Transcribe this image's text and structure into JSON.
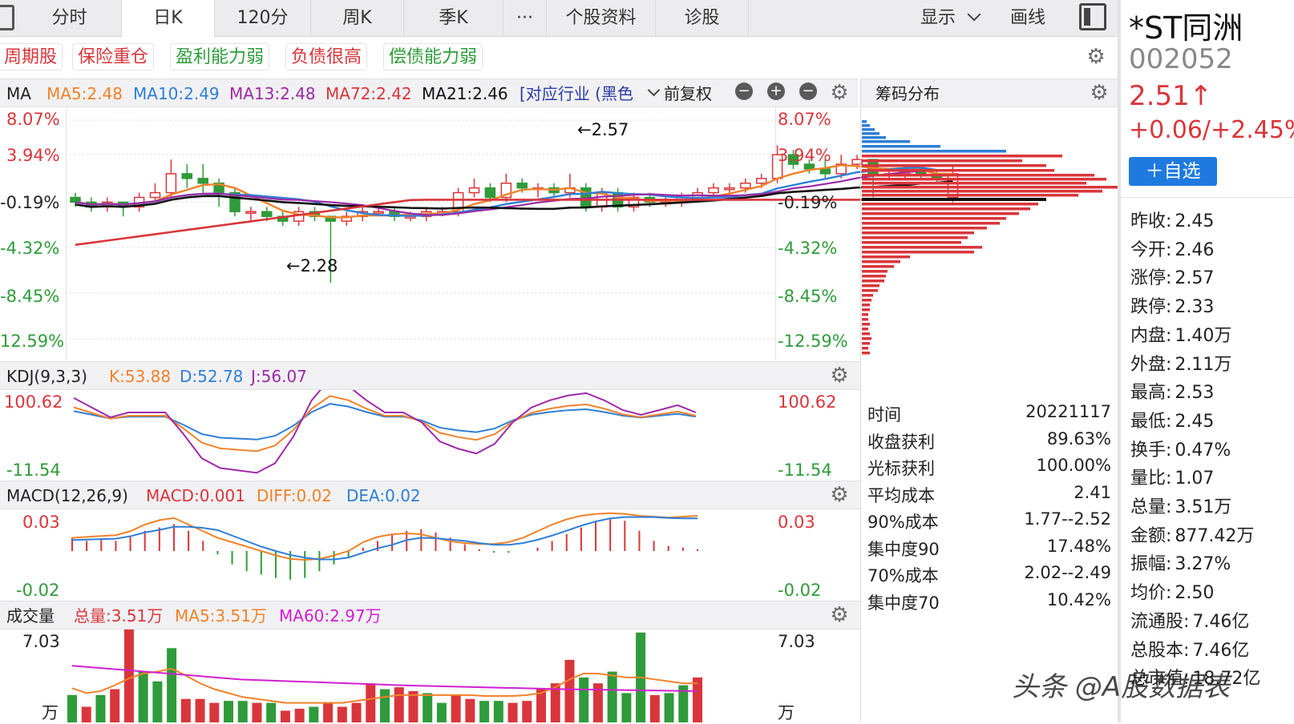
{
  "tabs": [
    {
      "label": "分时",
      "active": false
    },
    {
      "label": "日K",
      "active": true
    },
    {
      "label": "120分",
      "active": false
    },
    {
      "label": "周K",
      "active": false
    },
    {
      "label": "季K",
      "active": false
    },
    {
      "label": "···",
      "active": false
    },
    {
      "label": "个股资料",
      "active": false
    },
    {
      "label": "诊股",
      "active": false
    }
  ],
  "toolbar": {
    "display_label": "显示",
    "draw_label": "画线"
  },
  "tags": [
    {
      "label": "周期股",
      "color": "red"
    },
    {
      "label": "保险重仓",
      "color": "red"
    },
    {
      "label": "盈利能力弱",
      "color": "green"
    },
    {
      "label": "负债很高",
      "color": "red"
    },
    {
      "label": "偿债能力弱",
      "color": "green"
    }
  ],
  "ma_header": {
    "title": "MA",
    "ma5": "MA5:2.48",
    "ma10": "MA10:2.49",
    "ma13": "MA13:2.48",
    "ma72": "MA72:2.42",
    "ma21": "MA21:2.46",
    "industry": "[对应行业 (黑色",
    "adjust": "前复权"
  },
  "price_axis": [
    "8.07%",
    "3.94%",
    "-0.19%",
    "-4.32%",
    "-8.45%",
    "12.59%"
  ],
  "price_axis_right": [
    "8.07%",
    "3.94%",
    "-0.19%",
    "-4.32%",
    "-8.45%",
    "-12.59%"
  ],
  "annotations": {
    "high": "←2.57",
    "low": "←2.28"
  },
  "chip": {
    "title": "筹码分布",
    "rows": [
      {
        "k": "时间",
        "v": "20221117"
      },
      {
        "k": "收盘获利",
        "v": "89.63%"
      },
      {
        "k": "光标获利",
        "v": "100.00%"
      },
      {
        "k": "平均成本",
        "v": "2.41"
      },
      {
        "k": "90%成本",
        "v": "1.77--2.52"
      },
      {
        "k": "集中度90",
        "v": "17.48%"
      },
      {
        "k": "70%成本",
        "v": "2.02--2.49"
      },
      {
        "k": "集中度70",
        "v": "10.42%"
      }
    ]
  },
  "kdj": {
    "title": "KDJ(9,3,3)",
    "k": "K:53.88",
    "d": "D:52.78",
    "j": "J:56.07",
    "top": "100.62",
    "bottom": "-11.54"
  },
  "macd": {
    "title": "MACD(12,26,9)",
    "macd": "MACD:0.001",
    "diff": "DIFF:0.02",
    "dea": "DEA:0.02",
    "top": "0.03",
    "bottom": "-0.02"
  },
  "volume": {
    "title": "成交量",
    "total": "总量:3.51万",
    "ma5": "MA5:3.51万",
    "ma60": "MA60:2.97万",
    "top": "7.03",
    "unit": "万"
  },
  "stock": {
    "name": "*ST同洲",
    "code": "002052",
    "price": "2.51↑",
    "change": "+0.06/+2.45%",
    "watch_label": "＋自选"
  },
  "quote": [
    {
      "k": "昨收:",
      "v": "2.45",
      "c": "black"
    },
    {
      "k": "今开:",
      "v": "2.46",
      "c": "red"
    },
    {
      "k": "涨停:",
      "v": "2.57",
      "c": "red"
    },
    {
      "k": "跌停:",
      "v": "2.33",
      "c": "green"
    },
    {
      "k": "内盘:",
      "v": "1.40万",
      "c": "green"
    },
    {
      "k": "外盘:",
      "v": "2.11万",
      "c": "red"
    },
    {
      "k": "最高:",
      "v": "2.53",
      "c": "red"
    },
    {
      "k": "最低:",
      "v": "2.45",
      "c": "black"
    },
    {
      "k": "换手:",
      "v": "0.47%",
      "c": "black"
    },
    {
      "k": "量比:",
      "v": "1.07",
      "c": "black"
    },
    {
      "k": "总量:",
      "v": "3.51万",
      "c": "black"
    },
    {
      "k": "金额:",
      "v": "877.42万",
      "c": "black"
    },
    {
      "k": "振幅:",
      "v": "3.27%",
      "c": "black"
    },
    {
      "k": "均价:",
      "v": "2.50",
      "c": "red"
    },
    {
      "k": "流通股:",
      "v": "7.46亿",
      "c": "black"
    },
    {
      "k": "总股本:",
      "v": "7.46亿",
      "c": "black"
    },
    {
      "k": "总市值:",
      "v": "18.72亿",
      "c": "black"
    }
  ],
  "watermark": "头条 @A股数据表",
  "colors": {
    "up": "#d9363b",
    "down": "#2f9b3a",
    "ma5": "#f0822a",
    "ma10": "#2f7fd6",
    "ma13": "#9c2aa6",
    "ma72": "#d9363b",
    "ma21": "#111111",
    "accent": "#1f7ae0"
  },
  "chart_data": [
    {
      "type": "candlestick",
      "title": "日K",
      "ohlc": [
        [
          2.46,
          2.45,
          2.44,
          2.47
        ],
        [
          2.45,
          2.44,
          2.43,
          2.46
        ],
        [
          2.44,
          2.45,
          2.43,
          2.46
        ],
        [
          2.45,
          2.44,
          2.42,
          2.45
        ],
        [
          2.44,
          2.46,
          2.43,
          2.47
        ],
        [
          2.46,
          2.47,
          2.45,
          2.49
        ],
        [
          2.47,
          2.51,
          2.46,
          2.54
        ],
        [
          2.51,
          2.5,
          2.48,
          2.53
        ],
        [
          2.5,
          2.49,
          2.47,
          2.53
        ],
        [
          2.49,
          2.47,
          2.44,
          2.5
        ],
        [
          2.47,
          2.43,
          2.42,
          2.48
        ],
        [
          2.43,
          2.43,
          2.41,
          2.44
        ],
        [
          2.43,
          2.42,
          2.41,
          2.44
        ],
        [
          2.42,
          2.41,
          2.4,
          2.43
        ],
        [
          2.41,
          2.43,
          2.4,
          2.44
        ],
        [
          2.43,
          2.42,
          2.41,
          2.44
        ],
        [
          2.42,
          2.41,
          2.28,
          2.42
        ],
        [
          2.41,
          2.42,
          2.4,
          2.43
        ],
        [
          2.42,
          2.43,
          2.41,
          2.44
        ],
        [
          2.43,
          2.43,
          2.42,
          2.44
        ],
        [
          2.43,
          2.42,
          2.41,
          2.44
        ],
        [
          2.42,
          2.42,
          2.41,
          2.43
        ],
        [
          2.42,
          2.43,
          2.41,
          2.44
        ],
        [
          2.43,
          2.43,
          2.42,
          2.44
        ],
        [
          2.43,
          2.47,
          2.42,
          2.48
        ],
        [
          2.47,
          2.48,
          2.46,
          2.5
        ],
        [
          2.48,
          2.46,
          2.45,
          2.49
        ],
        [
          2.46,
          2.49,
          2.45,
          2.51
        ],
        [
          2.49,
          2.48,
          2.47,
          2.5
        ],
        [
          2.48,
          2.48,
          2.46,
          2.49
        ],
        [
          2.48,
          2.47,
          2.46,
          2.49
        ],
        [
          2.47,
          2.48,
          2.46,
          2.51
        ],
        [
          2.48,
          2.44,
          2.43,
          2.49
        ],
        [
          2.44,
          2.47,
          2.43,
          2.48
        ],
        [
          2.47,
          2.44,
          2.43,
          2.48
        ],
        [
          2.44,
          2.46,
          2.43,
          2.47
        ],
        [
          2.46,
          2.45,
          2.44,
          2.47
        ],
        [
          2.45,
          2.45,
          2.44,
          2.46
        ],
        [
          2.45,
          2.46,
          2.44,
          2.47
        ],
        [
          2.46,
          2.47,
          2.45,
          2.48
        ],
        [
          2.47,
          2.48,
          2.46,
          2.49
        ],
        [
          2.48,
          2.48,
          2.47,
          2.49
        ],
        [
          2.48,
          2.49,
          2.47,
          2.5
        ],
        [
          2.49,
          2.5,
          2.48,
          2.51
        ],
        [
          2.5,
          2.55,
          2.49,
          2.57
        ],
        [
          2.55,
          2.53,
          2.52,
          2.56
        ],
        [
          2.53,
          2.52,
          2.51,
          2.54
        ],
        [
          2.52,
          2.51,
          2.5,
          2.54
        ],
        [
          2.51,
          2.53,
          2.5,
          2.55
        ],
        [
          2.53,
          2.54,
          2.52,
          2.55
        ],
        [
          2.54,
          2.51,
          2.46,
          2.54
        ],
        [
          2.51,
          2.51,
          2.5,
          2.52
        ],
        [
          2.51,
          2.52,
          2.5,
          2.53
        ],
        [
          2.52,
          2.51,
          2.5,
          2.52
        ],
        [
          2.51,
          2.5,
          2.49,
          2.52
        ],
        [
          2.46,
          2.51,
          2.45,
          2.53
        ]
      ],
      "ylim": [
        2.14,
        2.65
      ]
    }
  ]
}
